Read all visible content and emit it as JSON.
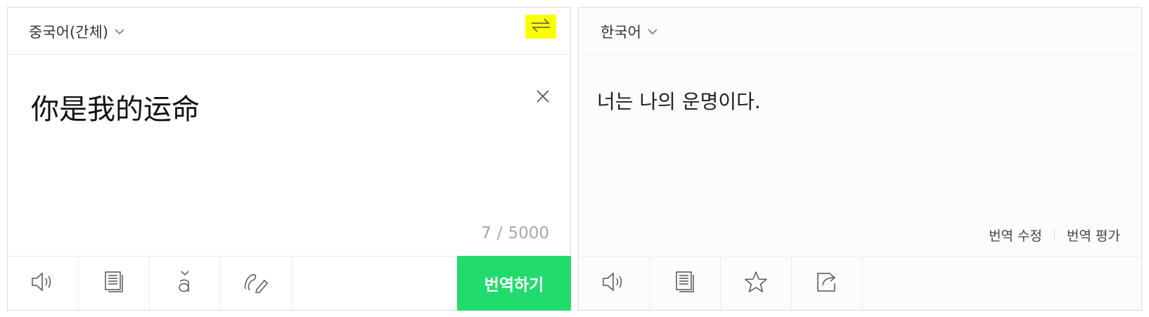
{
  "source": {
    "language": "중국어(간체)",
    "text": "你是我的运命",
    "char_count": "7",
    "char_sep": "/",
    "char_max": "5000",
    "translate_label": "번역하기",
    "tools": [
      "speaker-icon",
      "copy-icon",
      "pinyin-icon",
      "handwriting-icon"
    ]
  },
  "target": {
    "language": "한국어",
    "text": "너는 나의 운명이다.",
    "edit_label": "번역 수정",
    "rate_label": "번역 평가",
    "tools": [
      "speaker-icon",
      "copy-icon",
      "star-icon",
      "share-icon"
    ]
  },
  "colors": {
    "translate_button": "#21db6d",
    "swap_highlight": "#fbff00"
  }
}
